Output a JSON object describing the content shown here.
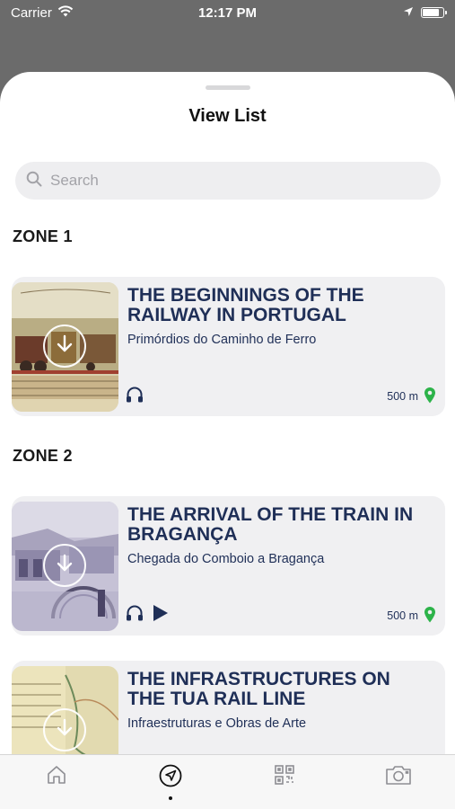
{
  "status_bar": {
    "carrier": "Carrier",
    "time": "12:17 PM",
    "battery_percent": 85
  },
  "sheet": {
    "title": "View List"
  },
  "search": {
    "placeholder": "Search"
  },
  "zones": [
    {
      "label": "ZONE 1"
    },
    {
      "label": "ZONE 2"
    }
  ],
  "items": [
    {
      "title": "THE BEGINNINGS OF THE RAILWAY IN PORTUGAL",
      "subtitle": "Primórdios do Caminho de Ferro",
      "distance": "500 m",
      "has_play": false
    },
    {
      "title": "THE ARRIVAL OF THE TRAIN IN BRAGANÇA",
      "subtitle": "Chegada do Comboio a Bragança",
      "distance": "500 m",
      "has_play": true
    },
    {
      "title": "THE INFRASTRUCTURES ON THE TUA RAIL LINE",
      "subtitle": "Infraestruturas e Obras de Arte"
    }
  ],
  "tabs": [
    {
      "name": "home-icon",
      "active": false
    },
    {
      "name": "navigation-icon",
      "active": true
    },
    {
      "name": "qr-code-icon",
      "active": false
    },
    {
      "name": "camera-icon",
      "active": false
    }
  ],
  "colors": {
    "title_navy": "#1f2f57",
    "pin_green": "#2db34a",
    "card_bg": "#f0f0f2"
  }
}
